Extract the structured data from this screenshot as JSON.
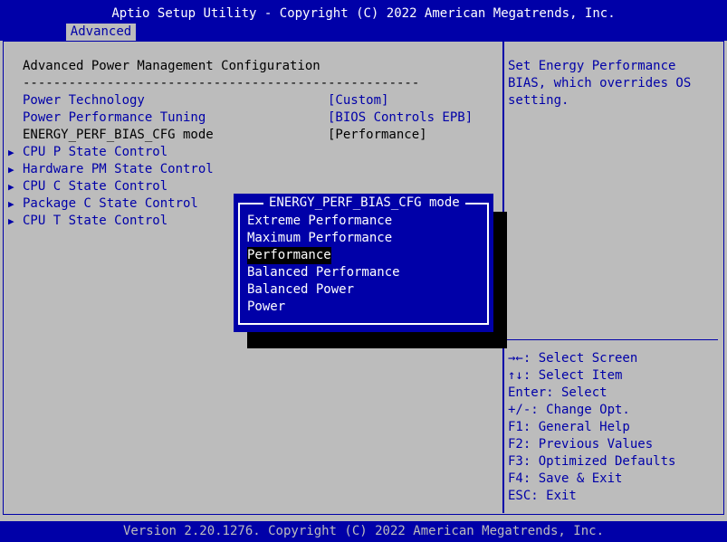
{
  "header": {
    "title": "Aptio Setup Utility - Copyright (C) 2022 American Megatrends, Inc.",
    "tab": "Advanced"
  },
  "main": {
    "section_title": "Advanced Power Management Configuration",
    "separator": "----------------------------------------------------",
    "settings": [
      {
        "label": "Power Technology",
        "value": "[Custom]"
      },
      {
        "label": "Power Performance Tuning",
        "value": "[BIOS Controls EPB]"
      },
      {
        "label": "ENERGY_PERF_BIAS_CFG mode",
        "value": "[Performance]"
      }
    ],
    "submenus": [
      "CPU P State Control",
      "Hardware PM State Control",
      "CPU C State Control",
      "Package C State Control",
      "CPU T State Control"
    ]
  },
  "help": {
    "text": "Set Energy Performance BIAS, which overrides OS setting."
  },
  "keys": [
    "→←: Select Screen",
    "↑↓: Select Item",
    "Enter: Select",
    "+/-: Change Opt.",
    "F1: General Help",
    "F2: Previous Values",
    "F3: Optimized Defaults",
    "F4: Save & Exit",
    "ESC: Exit"
  ],
  "popup": {
    "title": "ENERGY_PERF_BIAS_CFG mode",
    "options": [
      "Extreme Performance",
      "Maximum Performance",
      "Performance",
      "Balanced Performance",
      "Balanced Power",
      "Power"
    ],
    "selected_index": 2
  },
  "footer": {
    "text": "Version 2.20.1276. Copyright (C) 2022 American Megatrends, Inc."
  },
  "colors": {
    "bios_blue": "#0000a8",
    "background_gray": "#bcbcbc",
    "highlight_white": "#ffffff",
    "selection_black": "#000000"
  },
  "icons": {
    "submenu_marker": "triangle-right-icon"
  }
}
